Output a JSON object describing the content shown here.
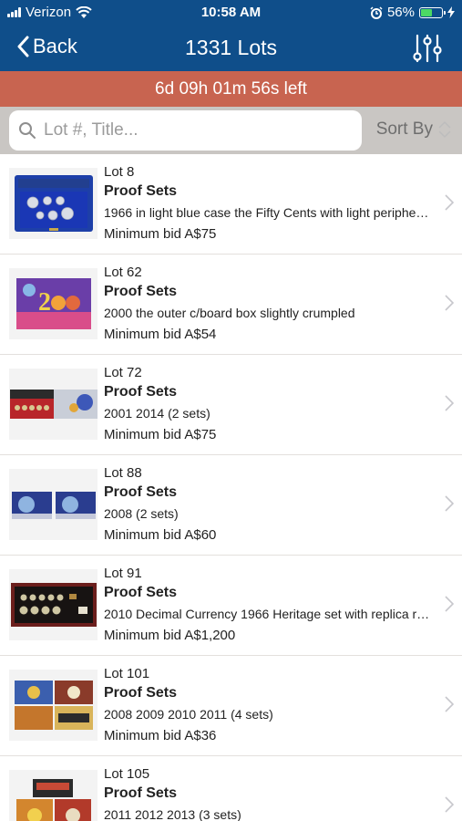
{
  "status_bar": {
    "carrier": "Verizon",
    "time": "10:58 AM",
    "battery_percent": "56%",
    "battery_level": 0.56,
    "icons": [
      "signal-icon",
      "wifi-icon",
      "alarm-icon",
      "battery-icon",
      "charging-icon"
    ]
  },
  "nav": {
    "back_label": "Back",
    "title": "1331 Lots",
    "filter_icon": "sliders-icon"
  },
  "timer": {
    "text": "6d 09h 01m 56s left"
  },
  "search": {
    "placeholder": "Lot #, Title...",
    "value": "",
    "sort_label": "Sort By"
  },
  "colors": {
    "nav_blue": "#0f4e8a",
    "timer_red": "#c86450",
    "search_bg": "#c9c6c3"
  },
  "lots": [
    {
      "lot": "Lot 8",
      "category": "Proof Sets",
      "description": "1966 in light blue case the Fifty Cents with light periphe…",
      "min_bid": "Minimum bid A$75",
      "thumb": "blue-case-proof-set"
    },
    {
      "lot": "Lot 62",
      "category": "Proof Sets",
      "description": "2000 the outer c/board box slightly crumpled",
      "min_bid": "Minimum bid A$54",
      "thumb": "purple-2000-box"
    },
    {
      "lot": "Lot 72",
      "category": "Proof Sets",
      "description": "2001 2014 (2 sets)",
      "min_bid": "Minimum bid A$75",
      "thumb": "two-proof-sets"
    },
    {
      "lot": "Lot 88",
      "category": "Proof Sets",
      "description": "2008 (2 sets)",
      "min_bid": "Minimum bid A$60",
      "thumb": "two-blue-sets"
    },
    {
      "lot": "Lot 91",
      "category": "Proof Sets",
      "description": "2010 Decimal Currency 1966 Heritage set with replica r…",
      "min_bid": "Minimum bid A$1,200",
      "thumb": "framed-heritage-set"
    },
    {
      "lot": "Lot 101",
      "category": "Proof Sets",
      "description": "2008 2009 2010 2011 (4 sets)",
      "min_bid": "Minimum bid A$36",
      "thumb": "four-boxed-sets"
    },
    {
      "lot": "Lot 105",
      "category": "Proof Sets",
      "description": "2011 2012 2013 (3 sets)",
      "min_bid": "",
      "thumb": "stacked-sets"
    }
  ]
}
